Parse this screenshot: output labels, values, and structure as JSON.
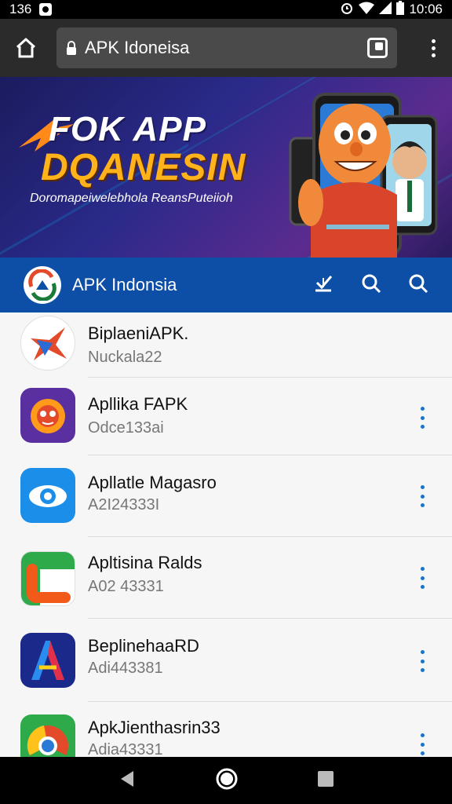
{
  "status_bar": {
    "time_left": "136",
    "time_right": "10:06"
  },
  "browser": {
    "url_text": "APK Idoneisa"
  },
  "banner": {
    "title_line1": "FOK APP",
    "title_line2": "DQANESIN",
    "subtitle": "Doromapeiwelebhola ReansPuteiioh"
  },
  "site_header": {
    "name": "APK Indonsia"
  },
  "apps": [
    {
      "title": "BiplaeniAPK.",
      "meta": "Nuckala22",
      "show_more": false
    },
    {
      "title": "Apllika FAPK",
      "meta": "Odce133ai",
      "show_more": true
    },
    {
      "title": "Apllatle Magasro",
      "meta": "A2I24333I",
      "show_more": true
    },
    {
      "title": "Apltisina Ralds",
      "meta": "A02 43331",
      "show_more": true
    },
    {
      "title": "BeplinehaaRD",
      "meta": "Adi443381",
      "show_more": true
    },
    {
      "title": "ApkJienthasrin33",
      "meta": "Adia43331",
      "show_more": true
    }
  ],
  "colors": {
    "header_blue": "#0d4ea6",
    "accent_orange": "#ffb21a",
    "more_dots": "#1a73c8"
  }
}
